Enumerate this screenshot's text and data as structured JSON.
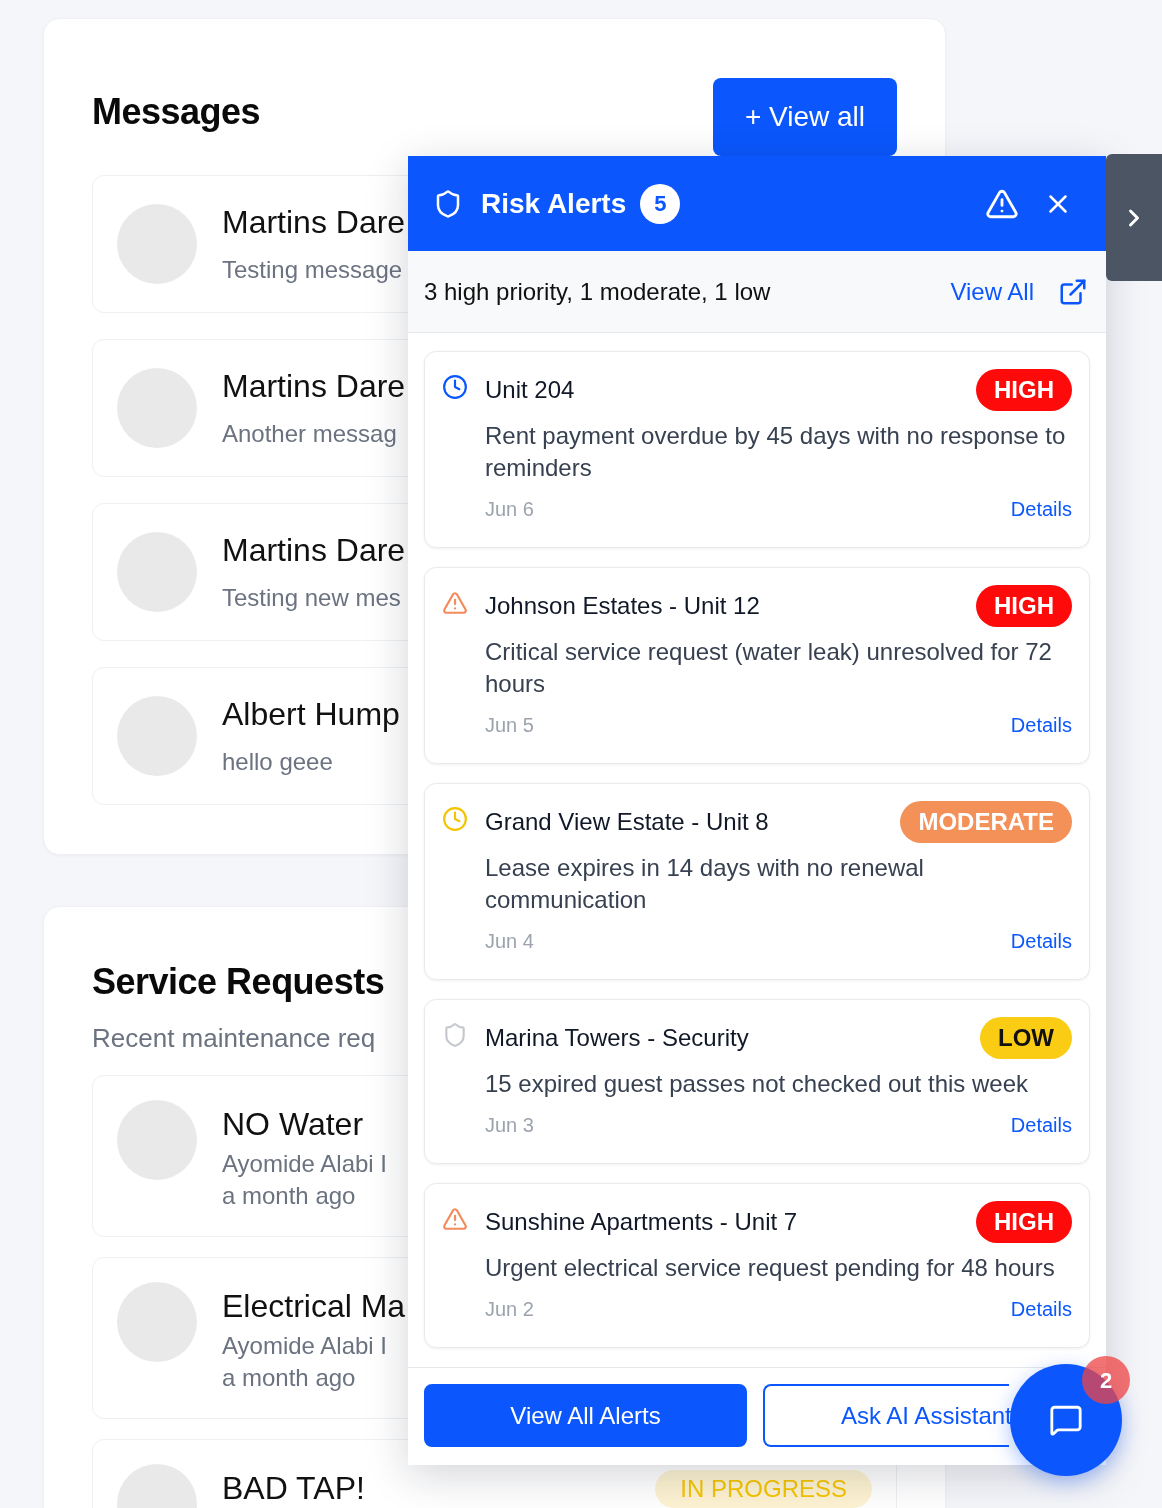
{
  "messages": {
    "title": "Messages",
    "view_all_button": "+ View all",
    "items": [
      {
        "name": "Martins Dare",
        "preview": "Testing message"
      },
      {
        "name": "Martins Dare",
        "preview": "Another messag"
      },
      {
        "name": "Martins Dare",
        "preview": "Testing new mes"
      },
      {
        "name": "Albert Hump",
        "preview": "hello geee"
      }
    ]
  },
  "service_requests": {
    "title": "Service Requests",
    "subtitle": "Recent maintenance req",
    "items": [
      {
        "title": "NO Water",
        "author": "Ayomide Alabi I",
        "time": "a month ago"
      },
      {
        "title": "Electrical Ma",
        "author": "Ayomide Alabi I",
        "time": "a month ago"
      },
      {
        "title": "BAD TAP!",
        "status": "IN PROGRESS"
      }
    ]
  },
  "risk_alerts": {
    "title": "Risk Alerts",
    "count": "5",
    "summary": "3 high priority, 1 moderate, 1 low",
    "view_all_link": "View All",
    "alerts": [
      {
        "icon": {
          "kind": "deadline",
          "color": "#0b57fd"
        },
        "title": "Unit 204",
        "badge": {
          "text": "HIGH",
          "color": "#ff0a0a"
        },
        "description": "Rent payment overdue by 45 days with no response to reminders",
        "date": "Jun 6",
        "link": "Details"
      },
      {
        "icon": {
          "kind": "urgent",
          "color": "#f4895a"
        },
        "title": "Johnson Estates - Unit 12",
        "badge": {
          "text": "HIGH",
          "color": "#ff0a0a"
        },
        "description": "Critical service request (water leak) unresolved for 72 hours",
        "date": "Jun 5",
        "link": "Details"
      },
      {
        "icon": {
          "kind": "deadline",
          "color": "#f5c400"
        },
        "title": "Grand View Estate - Unit 8",
        "badge": {
          "text": "MODERATE",
          "color": "#f39159"
        },
        "description": "Lease expires in 14 days with no renewal communication",
        "date": "Jun 4",
        "link": "Details"
      },
      {
        "icon": {
          "kind": "security",
          "color": "#c5c9cf"
        },
        "title": "Marina Towers - Security",
        "badge": {
          "text": "LOW",
          "color": "#fbcc14"
        },
        "description": "15 expired guest passes not checked out this week",
        "date": "Jun 3",
        "link": "Details"
      },
      {
        "icon": {
          "kind": "urgent",
          "color": "#f4895a"
        },
        "title": "Sunshine Apartments - Unit 7",
        "badge": {
          "text": "HIGH",
          "color": "#ff0a0a"
        },
        "description": "Urgent electrical service request pending for 48 hours",
        "date": "Jun 2",
        "link": "Details"
      }
    ],
    "footer_buttons": [
      {
        "label": "View All Alerts",
        "kind": "primary"
      },
      {
        "label": "Ask AI Assistant",
        "kind": "outline"
      }
    ]
  },
  "chat": {
    "badge": "2"
  }
}
